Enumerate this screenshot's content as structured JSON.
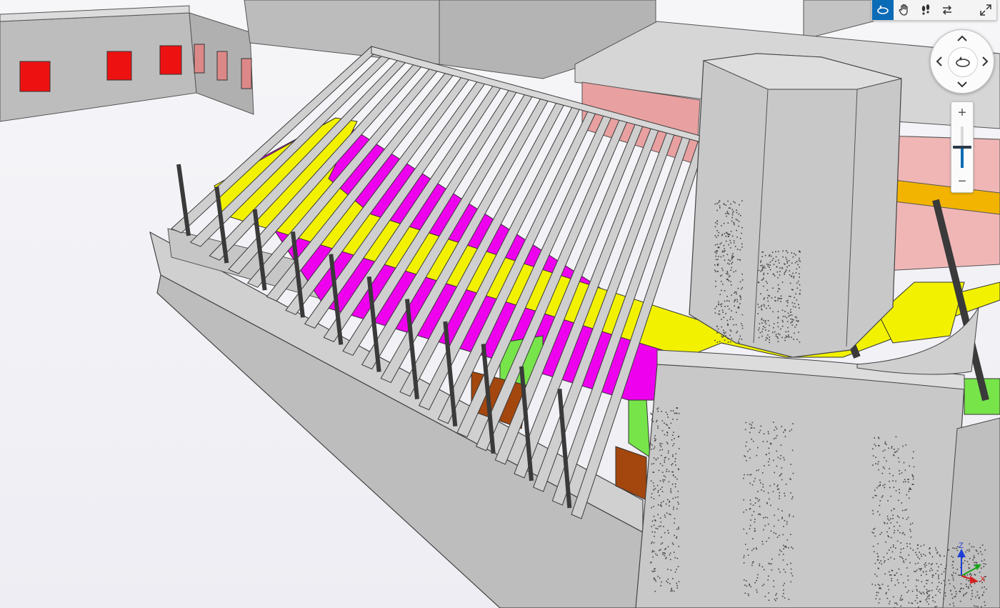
{
  "toolbar": {
    "tools": [
      {
        "id": "orbit",
        "icon": "orbit-icon",
        "active": true
      },
      {
        "id": "pan",
        "icon": "pan-hand-icon",
        "active": false
      },
      {
        "id": "walk",
        "icon": "footsteps-icon",
        "active": false
      },
      {
        "id": "swap",
        "icon": "swap-arrows-icon",
        "active": false
      },
      {
        "id": "fullscreen",
        "icon": "expand-icon",
        "active": false
      }
    ],
    "active_color": "#0a6bb6"
  },
  "navigation": {
    "arrows": [
      "up",
      "down",
      "left",
      "right"
    ],
    "center_icon": "orbit-icon"
  },
  "zoom": {
    "plus_label": "+",
    "minus_label": "−",
    "level_fraction": 0.5
  },
  "axis_triad": {
    "z_label": "Z",
    "x_label": "X",
    "colors": {
      "z": "#1f3fd6",
      "y": "#1aa31a",
      "x": "#d62020"
    }
  },
  "scene_colors": {
    "structure": "#c8c8c8",
    "duct_magenta": "#ee00ee",
    "duct_yellow": "#f2f200",
    "pipe_green": "#77e44a",
    "brown_element": "#a3470e",
    "window_red": "#ee1111"
  }
}
